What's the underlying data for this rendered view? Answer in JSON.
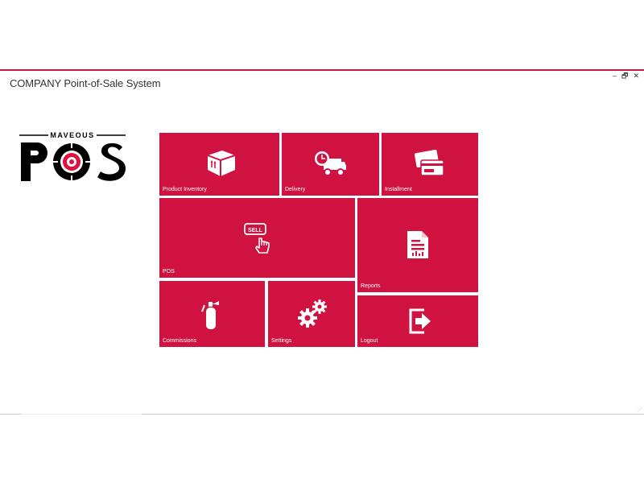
{
  "window": {
    "title": "COMPANY Point-of-Sale System",
    "controls": {
      "minimize": "–",
      "restore": "🗗",
      "close": "✕"
    }
  },
  "logo": {
    "brand": "MAVEOUS",
    "product": "POS"
  },
  "colors": {
    "accent": "#cf1240",
    "top_bar": "#c01a45",
    "logo_ring": "#e0103f",
    "text": "#333333"
  },
  "tiles": {
    "product_inventory": {
      "label": "Product Inventory",
      "icon": "box-icon"
    },
    "delivery": {
      "label": "Delivery",
      "icon": "delivery-truck-icon"
    },
    "installment": {
      "label": "Installment",
      "icon": "credit-cards-icon"
    },
    "pos": {
      "label": "POS",
      "icon": "sell-button-icon"
    },
    "reports": {
      "label": "Reports",
      "icon": "report-document-icon"
    },
    "commissions": {
      "label": "Commissions",
      "icon": "fire-extinguisher-icon"
    },
    "settings": {
      "label": "Settings",
      "icon": "gears-icon"
    },
    "logout": {
      "label": "Logout",
      "icon": "logout-icon"
    }
  }
}
